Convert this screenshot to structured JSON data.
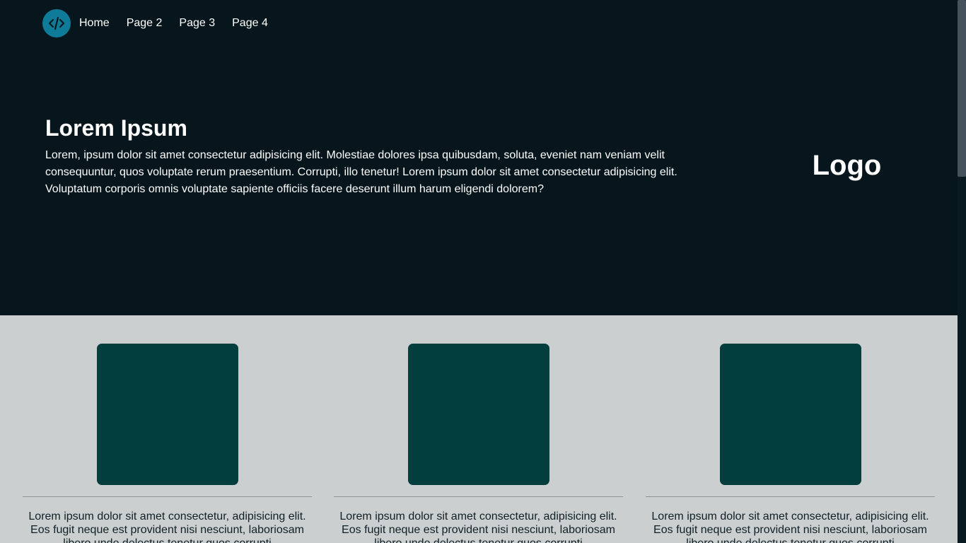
{
  "nav": {
    "logo_icon": "code-icon",
    "links": [
      "Home",
      "Page 2",
      "Page 3",
      "Page 4"
    ]
  },
  "hero": {
    "title": "Lorem Ipsum",
    "body": "Lorem, ipsum dolor sit amet consectetur adipisicing elit. Molestiae dolores ipsa quibusdam, soluta, eveniet nam veniam velit consequuntur, quos voluptate rerum praesentium. Corrupti, illo tenetur! Lorem ipsum dolor sit amet consectetur adipisicing elit. Voluptatum corporis omnis voluptate sapiente officiis facere deserunt illum harum eligendi dolorem?",
    "logo_text": "Logo"
  },
  "cards": [
    {
      "text": "Lorem ipsum dolor sit amet consectetur, adipisicing elit. Eos fugit neque est provident nisi nesciunt, laboriosam libero unde delectus tenetur quos corrupti"
    },
    {
      "text": "Lorem ipsum dolor sit amet consectetur, adipisicing elit. Eos fugit neque est provident nisi nesciunt, laboriosam libero unde delectus tenetur quos corrupti"
    },
    {
      "text": "Lorem ipsum dolor sit amet consectetur, adipisicing elit. Eos fugit neque est provident nisi nesciunt, laboriosam libero unde delectus tenetur quos corrupti"
    }
  ],
  "colors": {
    "hero_background": "#07161d",
    "logo_circle": "#0e7c98",
    "cards_background": "#cccfcf",
    "card_image": "#033e3f"
  }
}
